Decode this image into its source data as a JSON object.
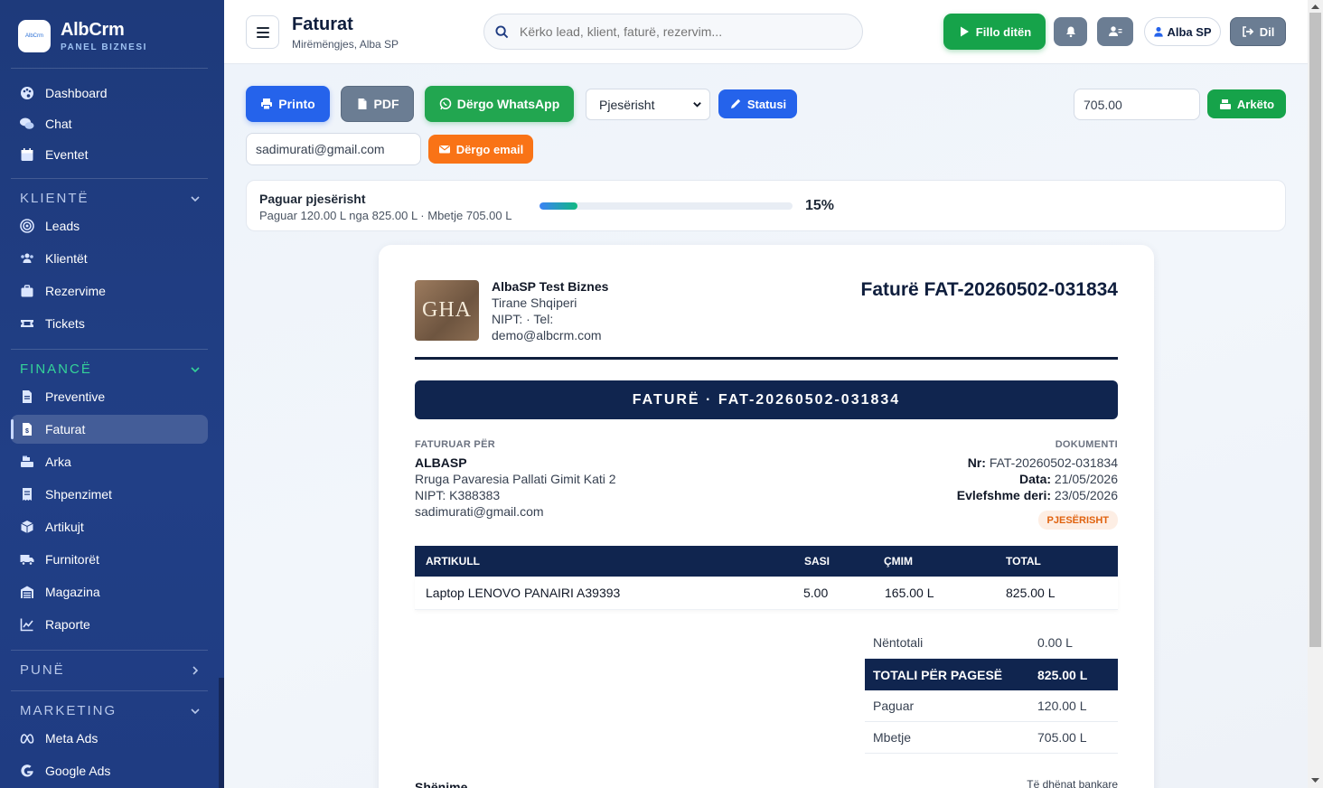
{
  "app": {
    "name": "AlbCrm",
    "subtitle": "PANEL BIZNESI",
    "logo_text": "AlbCrm"
  },
  "sidebar": {
    "items_top": [
      {
        "label": "Dashboard",
        "icon": "palette-icon"
      },
      {
        "label": "Chat",
        "icon": "comments-icon"
      },
      {
        "label": "Eventet",
        "icon": "calendar-icon"
      }
    ],
    "sections": [
      {
        "label": "KLIENTË",
        "state": "expanded",
        "items": [
          {
            "label": "Leads",
            "icon": "target-icon"
          },
          {
            "label": "Klientët",
            "icon": "users-icon"
          },
          {
            "label": "Rezervime",
            "icon": "briefcase-icon"
          },
          {
            "label": "Tickets",
            "icon": "ticket-icon"
          }
        ]
      },
      {
        "label": "FINANCË",
        "state": "expanded",
        "color": "#34d399",
        "items": [
          {
            "label": "Preventive",
            "icon": "document-icon"
          },
          {
            "label": "Faturat",
            "icon": "invoice-icon",
            "active": true
          },
          {
            "label": "Arka",
            "icon": "cash-register-icon"
          },
          {
            "label": "Shpenzimet",
            "icon": "receipt-icon"
          },
          {
            "label": "Artikujt",
            "icon": "box-icon"
          },
          {
            "label": "Furnitorët",
            "icon": "truck-icon"
          },
          {
            "label": "Magazina",
            "icon": "warehouse-icon"
          },
          {
            "label": "Raporte",
            "icon": "chart-line-icon"
          }
        ]
      },
      {
        "label": "PUNË",
        "state": "collapsed",
        "items": []
      },
      {
        "label": "MARKETING",
        "state": "expanded",
        "items": [
          {
            "label": "Meta Ads",
            "icon": "meta-icon"
          },
          {
            "label": "Google Ads",
            "icon": "google-icon"
          }
        ]
      }
    ]
  },
  "header": {
    "title": "Faturat",
    "subtitle": "Mirëmëngjes, Alba SP",
    "search_placeholder": "Kërko lead, klient, faturë, rezervim...",
    "start_day_label": "Fillo ditën",
    "user_label": "Alba SP",
    "logout_label": "Dil"
  },
  "toolbar": {
    "print_label": "Printo",
    "pdf_label": "PDF",
    "whatsapp_label": "Dërgo WhatsApp",
    "status_select_value": "Pjesërisht",
    "status_button_label": "Statusi",
    "amount_value": "705.00",
    "archive_label": "Arkëto",
    "email_value": "sadimurati@gmail.com",
    "send_email_label": "Dërgo email"
  },
  "progress": {
    "title": "Paguar pjesërisht",
    "detail": "Paguar 120.00 L nga 825.00 L · Mbetje 705.00 L",
    "percent": 15,
    "percent_label": "15%"
  },
  "invoice": {
    "company": {
      "logo_text": "GHA",
      "name": "AlbaSP Test Biznes",
      "address": "Tirane Shqiperi",
      "nipt_tel": "NIPT: · Tel:",
      "email": "demo@albcrm.com"
    },
    "heading": "Faturë FAT-20260502-031834",
    "banner": "FATURË · FAT-20260502-031834",
    "bill_to_label": "FATURUAR PËR",
    "client": {
      "name": "ALBASP",
      "address": "Rruga Pavaresia Pallati Gimit Kati 2",
      "nipt": "NIPT: K388383",
      "email": "sadimurati@gmail.com"
    },
    "doc_label": "DOKUMENTI",
    "nr_label": "Nr:",
    "nr_value": "FAT-20260502-031834",
    "date_label": "Data:",
    "date_value": "21/05/2026",
    "valid_label": "Evlefshme deri:",
    "valid_value": "23/05/2026",
    "status_badge": "PJESËRISHT",
    "columns": [
      "ARTIKULL",
      "SASI",
      "ÇMIM",
      "TOTAL"
    ],
    "rows": [
      {
        "item": "Laptop LENOVO PANAIRI A39393",
        "qty": "5.00",
        "price": "165.00 L",
        "total": "825.00 L"
      }
    ],
    "summary": {
      "subtotal_label": "Nëntotali",
      "subtotal_value": "0.00 L",
      "total_label": "TOTALI PËR PAGESË",
      "total_value": "825.00 L",
      "paid_label": "Paguar",
      "paid_value": "120.00 L",
      "remaining_label": "Mbetje",
      "remaining_value": "705.00 L"
    },
    "notes_label": "Shënime",
    "bank_label": "Të dhënat bankare"
  },
  "colors": {
    "primary": "#2563eb",
    "success": "#16a34a",
    "whatsapp": "#22a650",
    "orange": "#f97316",
    "navy": "#10254f",
    "sidebar": "#1e3a7b"
  }
}
